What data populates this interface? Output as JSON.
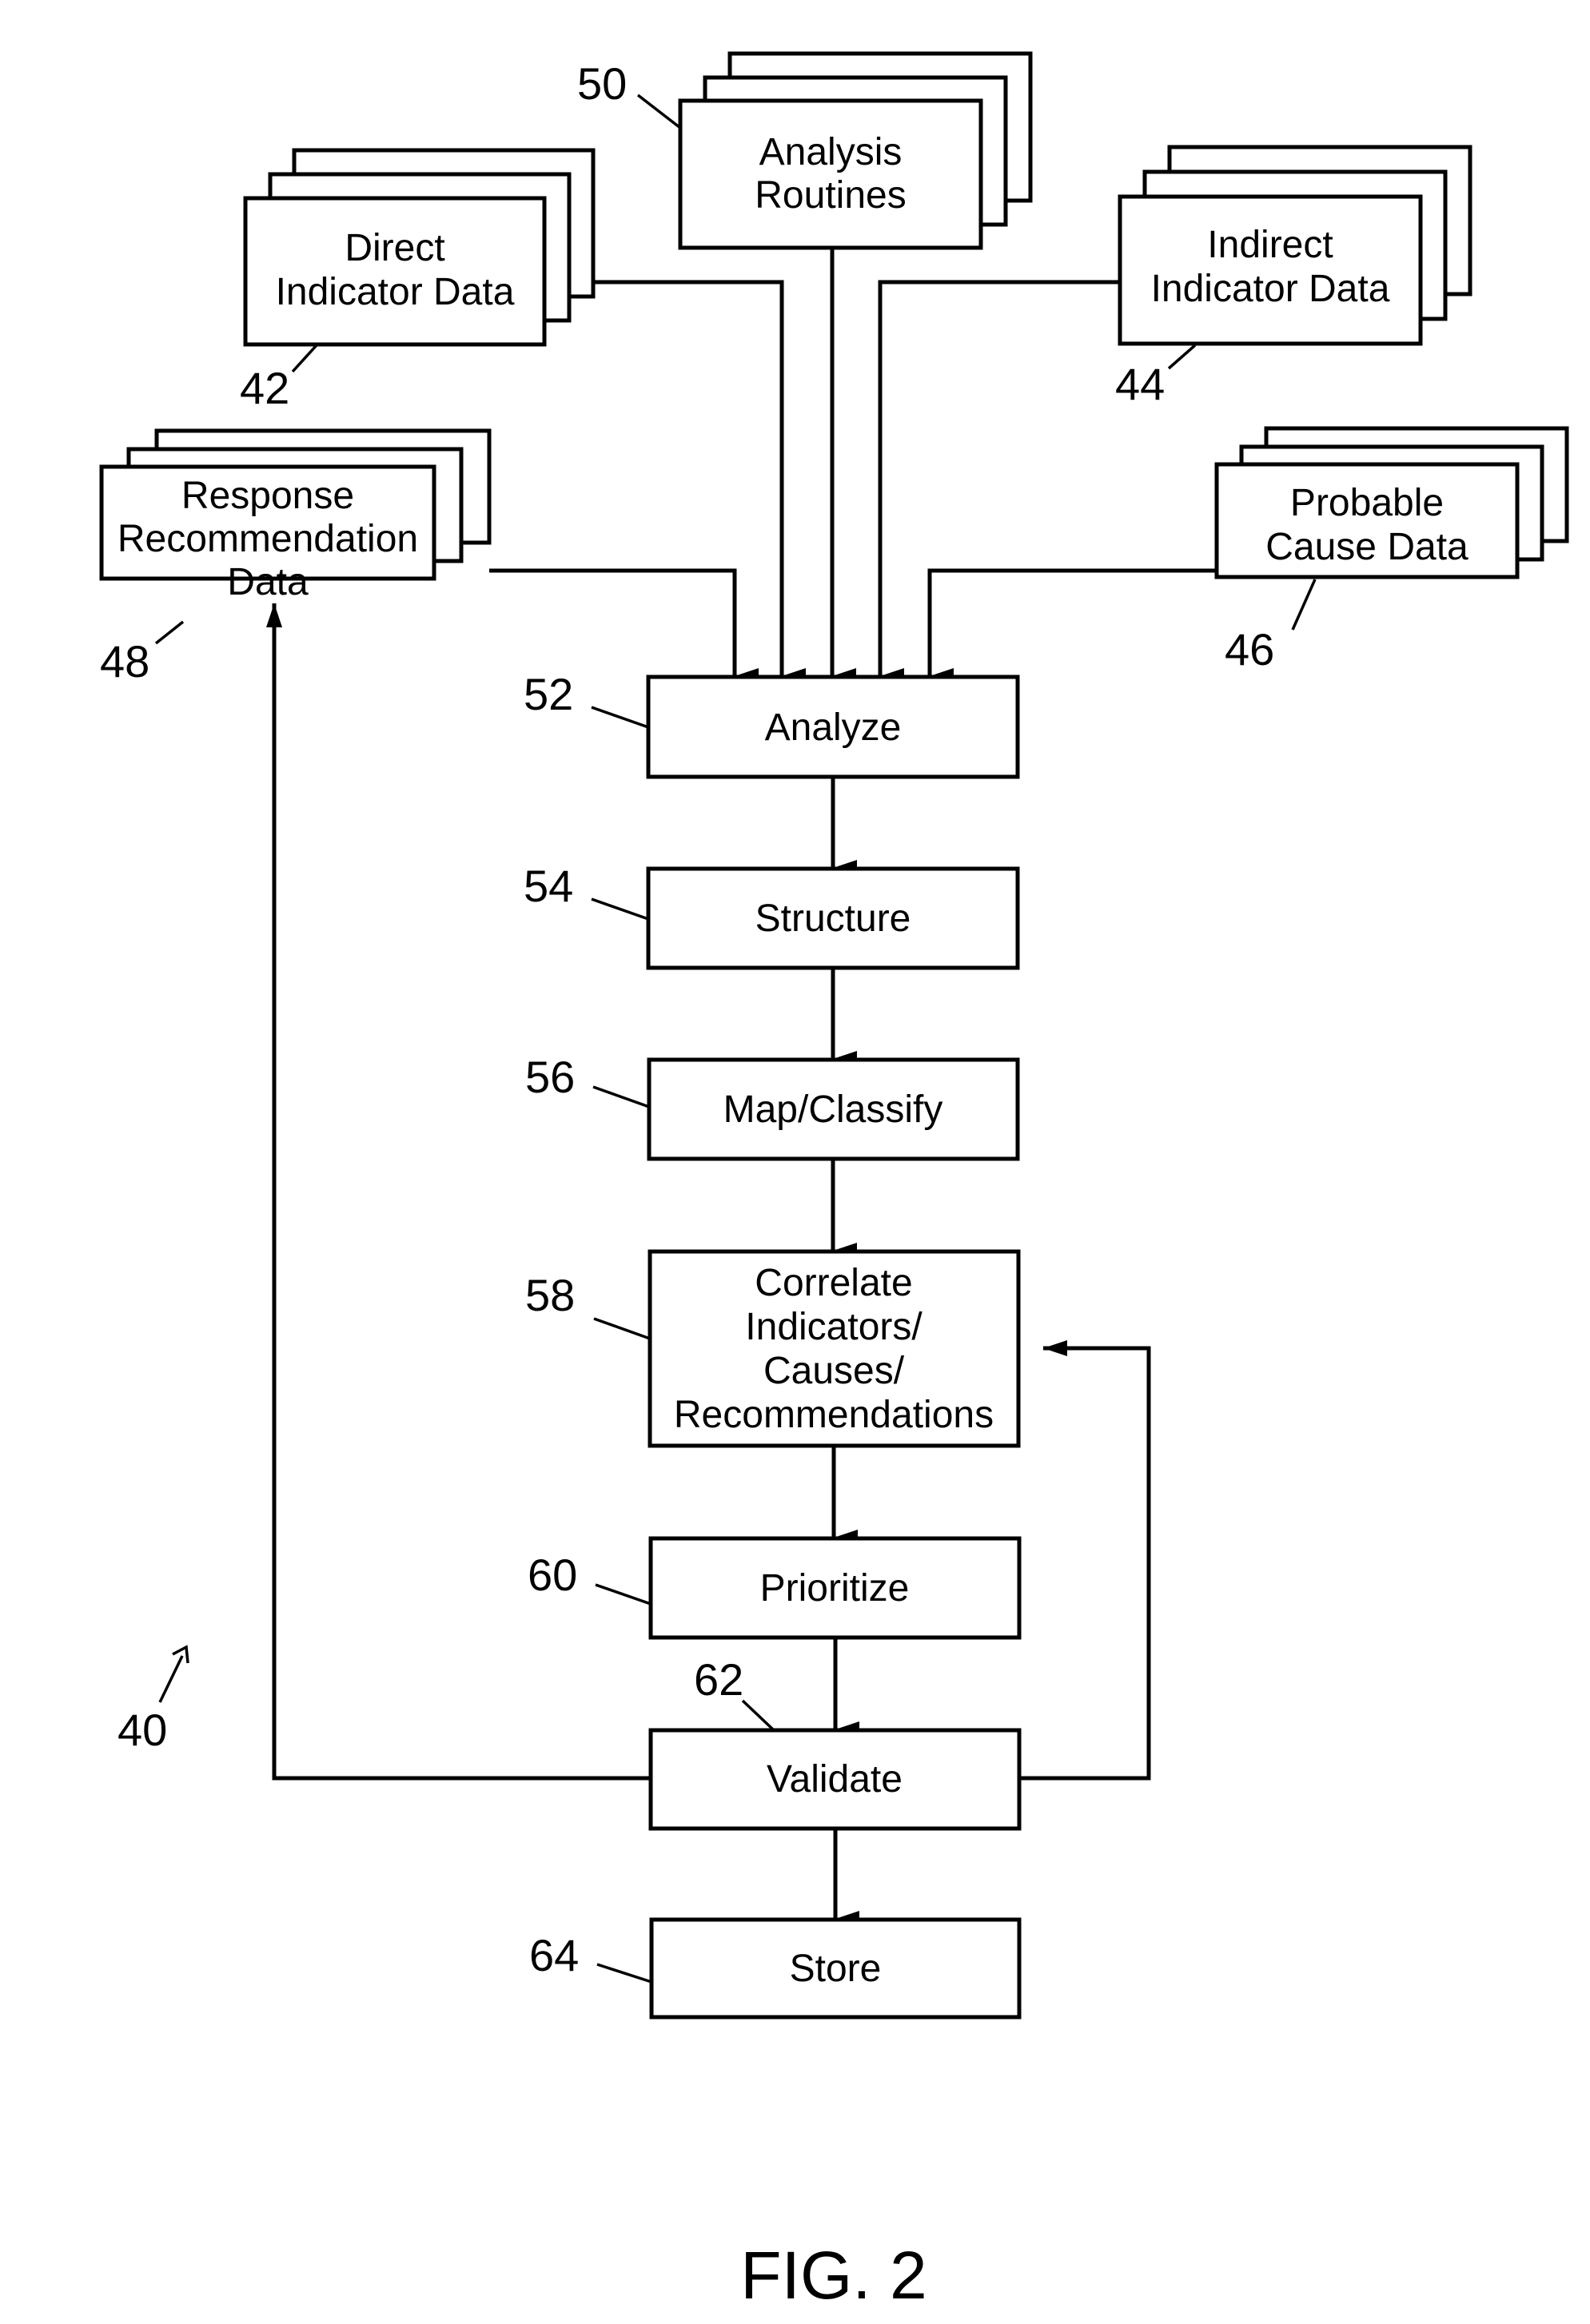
{
  "figure": {
    "caption": "FIG. 2",
    "reference_numeral": "40"
  },
  "data_sources": [
    {
      "id": "analysis-routines",
      "ref": "50",
      "lines": [
        "Analysis",
        "Routines"
      ]
    },
    {
      "id": "direct-indicator-data",
      "ref": "42",
      "lines": [
        "Direct",
        "Indicator Data"
      ]
    },
    {
      "id": "indirect-indicator-data",
      "ref": "44",
      "lines": [
        "Indirect",
        "Indicator Data"
      ]
    },
    {
      "id": "response-recommendation-data",
      "ref": "48",
      "lines": [
        "Response",
        "Recommendation",
        "Data"
      ]
    },
    {
      "id": "probable-cause-data",
      "ref": "46",
      "lines": [
        "Probable",
        "Cause Data"
      ]
    }
  ],
  "steps": [
    {
      "id": "analyze",
      "ref": "52",
      "lines": [
        "Analyze"
      ]
    },
    {
      "id": "structure",
      "ref": "54",
      "lines": [
        "Structure"
      ]
    },
    {
      "id": "map-classify",
      "ref": "56",
      "lines": [
        "Map/Classify"
      ]
    },
    {
      "id": "correlate",
      "ref": "58",
      "lines": [
        "Correlate",
        "Indicators/",
        "Causes/",
        "Recommendations"
      ]
    },
    {
      "id": "prioritize",
      "ref": "60",
      "lines": [
        "Prioritize"
      ]
    },
    {
      "id": "validate",
      "ref": "62",
      "lines": [
        "Validate"
      ]
    },
    {
      "id": "store",
      "ref": "64",
      "lines": [
        "Store"
      ]
    }
  ],
  "connections": [
    {
      "from": "response-recommendation-data",
      "to": "analyze"
    },
    {
      "from": "direct-indicator-data",
      "to": "analyze"
    },
    {
      "from": "analysis-routines",
      "to": "analyze"
    },
    {
      "from": "indirect-indicator-data",
      "to": "analyze"
    },
    {
      "from": "probable-cause-data",
      "to": "analyze"
    },
    {
      "from": "analyze",
      "to": "structure"
    },
    {
      "from": "structure",
      "to": "map-classify"
    },
    {
      "from": "map-classify",
      "to": "correlate"
    },
    {
      "from": "correlate",
      "to": "prioritize"
    },
    {
      "from": "prioritize",
      "to": "validate"
    },
    {
      "from": "validate",
      "to": "store"
    },
    {
      "from": "validate",
      "to": "correlate"
    },
    {
      "from": "validate",
      "to": "response-recommendation-data"
    }
  ]
}
